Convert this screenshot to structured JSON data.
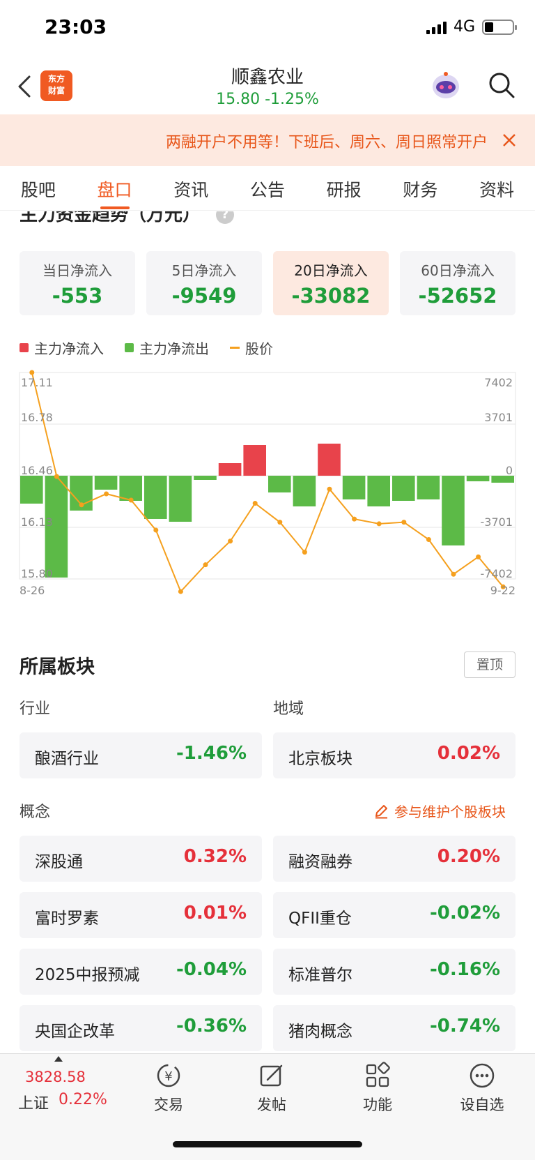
{
  "status": {
    "time": "23:03",
    "network": "4G"
  },
  "header": {
    "logo_line1": "东方",
    "logo_line2": "财富",
    "stock_name": "顺鑫农业",
    "stock_price": "15.80  -1.25%"
  },
  "banner": {
    "text": "两融开户不用等！下班后、周六、周日照常开户"
  },
  "tabs": [
    "股吧",
    "盘口",
    "资讯",
    "公告",
    "研报",
    "财务",
    "资料"
  ],
  "active_tab": 1,
  "section": {
    "title": "主力资金趋势（万元）"
  },
  "flow_cards": [
    {
      "label": "当日净流入",
      "value": "-553"
    },
    {
      "label": "5日净流入",
      "value": "-9549"
    },
    {
      "label": "20日净流入",
      "value": "-33082"
    },
    {
      "label": "60日净流入",
      "value": "-52652"
    }
  ],
  "legend": {
    "inflow": "主力净流入",
    "outflow": "主力净流出",
    "price": "股价"
  },
  "colors": {
    "inflow": "#e8434b",
    "outflow": "#5cba47",
    "price": "#f5a01e",
    "accent": "#f05a22"
  },
  "chart_data": {
    "type": "bar+line",
    "x_start_label": "8-26",
    "x_end_label": "9-22",
    "left_axis_ticks": [
      "17.11",
      "16.78",
      "16.46",
      "16.13",
      "15.80"
    ],
    "right_axis_ticks": [
      "7402",
      "3701",
      "0",
      "-3701",
      "-7402"
    ],
    "left_ylim": [
      15.8,
      17.11
    ],
    "right_ylim": [
      -7402,
      7402
    ],
    "net_flow": [
      -2000,
      -7300,
      -2500,
      -1000,
      -1800,
      -3100,
      -3300,
      -300,
      900,
      2200,
      -1200,
      -2200,
      2300,
      -1700,
      -2200,
      -1800,
      -1700,
      -5000,
      -400,
      -500
    ],
    "price": [
      17.11,
      16.45,
      16.27,
      16.34,
      16.3,
      16.11,
      15.72,
      15.89,
      16.04,
      16.28,
      16.16,
      15.97,
      16.37,
      16.18,
      16.15,
      16.16,
      16.05,
      15.83,
      15.94,
      15.75
    ]
  },
  "sectors": {
    "title": "所属板块",
    "pin": "置顶",
    "industry_label": "行业",
    "region_label": "地域",
    "industry": {
      "name": "酿酒行业",
      "change": "-1.46%"
    },
    "region": {
      "name": "北京板块",
      "change": "0.02%"
    },
    "concept_label": "概念",
    "maintain": "参与维护个股板块",
    "concepts": [
      {
        "name": "深股通",
        "change": "0.32%",
        "dir": "up"
      },
      {
        "name": "融资融券",
        "change": "0.20%",
        "dir": "up"
      },
      {
        "name": "富时罗素",
        "change": "0.01%",
        "dir": "up"
      },
      {
        "name": "QFII重仓",
        "change": "-0.02%",
        "dir": "down"
      },
      {
        "name": "2025中报预减",
        "change": "-0.04%",
        "dir": "down"
      },
      {
        "name": "标准普尔",
        "change": "-0.16%",
        "dir": "down"
      },
      {
        "name": "央国企改革",
        "change": "-0.36%",
        "dir": "down"
      },
      {
        "name": "猪肉概念",
        "change": "-0.74%",
        "dir": "down"
      }
    ]
  },
  "bottom_bar": {
    "index_value": "3828.58",
    "index_name": "上证",
    "index_change": "0.22%",
    "nav": [
      "交易",
      "发帖",
      "功能",
      "设自选"
    ]
  }
}
